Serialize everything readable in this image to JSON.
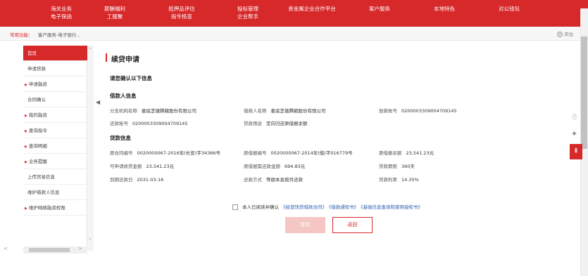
{
  "nav": [
    {
      "line1": "海关业务",
      "line2": "电子保函"
    },
    {
      "line1": "薪酬福利",
      "line2": "工服聚"
    },
    {
      "line1": "抵押品评估",
      "line2": "指令核查"
    },
    {
      "line1": "投标管理",
      "line2": "企业帮手"
    },
    {
      "line1": "贵金属企业合作平台",
      "line2": ""
    },
    {
      "line1": "客户服务",
      "line2": ""
    },
    {
      "line1": "本地特色",
      "line2": ""
    },
    {
      "line1": "对公钱包",
      "line2": ""
    }
  ],
  "common": {
    "label": "常用功能：",
    "item": "客户服务-电子银行...",
    "add": "添加",
    "add_icon": "+"
  },
  "sidebar": [
    {
      "label": "首页",
      "arrow": false,
      "active": true
    },
    {
      "label": "申请贷款",
      "arrow": false
    },
    {
      "label": "申请融资",
      "arrow": true
    },
    {
      "label": "合同确认",
      "arrow": false
    },
    {
      "label": "我的融资",
      "arrow": true
    },
    {
      "label": "查询指令",
      "arrow": true
    },
    {
      "label": "查询明细",
      "arrow": true
    },
    {
      "label": "业务提醒",
      "arrow": true
    },
    {
      "label": "上传贸易信息",
      "arrow": false
    },
    {
      "label": "维护借款人信息",
      "arrow": false
    },
    {
      "label": "维护网络融资权限",
      "arrow": true
    }
  ],
  "page": {
    "title": "续贷申请",
    "confirm": "请您确认以下信息",
    "borrower_head": "借款人信息",
    "loan_head": "贷款信息"
  },
  "borrower": {
    "branch_label": "分支机构名称",
    "branch_value": "娄底芝雄腾毓股份有限公司",
    "name_label": "借款人名称",
    "name_value": "娄底芝雄腾毓股份有限公司",
    "loan_acct_label": "放款账号",
    "loan_acct_value": "0200003309004709145",
    "repay_acct_label": "还款账号",
    "repay_acct_value": "0200003309004709145",
    "purpose_label": "贷款用途",
    "purpose_value": "定向归还原借据余额"
  },
  "loan": {
    "contract_label": "原合同编号",
    "contract_value": "0020000067-2016年(长安)字34366号",
    "receipt_label": "原借据编号",
    "receipt_value": "0020000067-2014年(借)字016779号",
    "balance_label": "原借据余额",
    "balance_value": "23,541.23元",
    "avail_label": "可申请续贷金额",
    "avail_value": "23,541.23元",
    "need_label": "原借据需还款金额",
    "need_value": "694.83元",
    "term_label": "贷款期限",
    "term_value": "360天",
    "due_label": "到期还款日",
    "due_value": "2031-03-16",
    "method_label": "还款方式",
    "method_value": "等额本息按月还款",
    "rate_label": "贷款利率",
    "rate_value": "14.35%"
  },
  "agree": {
    "text": "本人已阅读并确认",
    "link1": "《经营快贷借款合同》",
    "link2": "《借款通知书》",
    "link3": "《基础信息查询和使用授权书》"
  },
  "buttons": {
    "submit": "提交",
    "back": "返回"
  },
  "float": {
    "robot": "☃",
    "bulb": "✦",
    "top": "⇞"
  },
  "sb_arrows": {
    "up": "⌃",
    "down": "⌄",
    "left": "<",
    "right": ">"
  },
  "collapse": "◀"
}
